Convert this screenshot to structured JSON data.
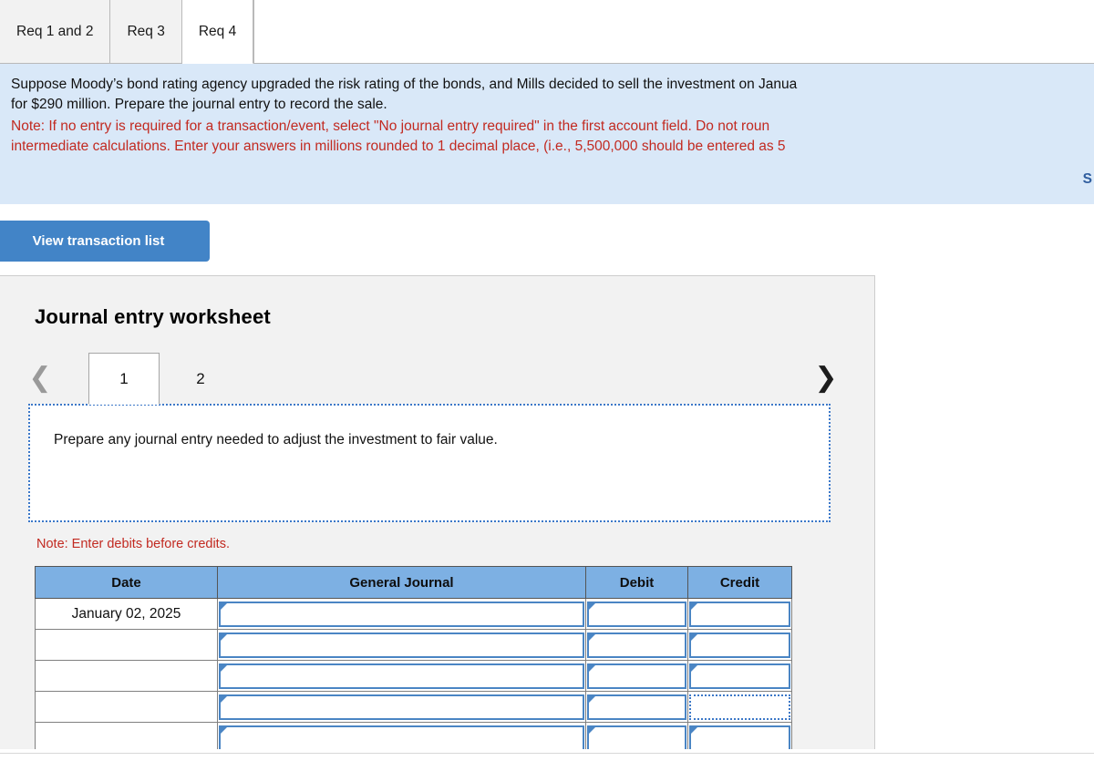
{
  "tabs": [
    {
      "label": "Req 1 and 2",
      "active": false
    },
    {
      "label": "Req 3",
      "active": false
    },
    {
      "label": "Req 4",
      "active": true
    }
  ],
  "banner": {
    "paragraph_line1": "Suppose Moody’s bond rating agency upgraded the risk rating of the bonds, and Mills decided to sell the investment on Janua",
    "paragraph_line2": "for $290 million. Prepare the journal entry to record the sale.",
    "note_line1": "Note: If no entry is required for a transaction/event, select \"No journal entry required\" in the first account field. Do not roun",
    "note_line2": "intermediate calculations. Enter your answers in millions rounded to 1 decimal place, (i.e., 5,500,000 should be entered as 5",
    "show_link": "S",
    "background_color": "#d9e8f8",
    "note_color": "#c22a21"
  },
  "buttons": {
    "view_transaction_list": "View transaction list"
  },
  "worksheet": {
    "title": "Journal entry worksheet",
    "pager": {
      "prev_icon": "chevron-left",
      "next_icon": "chevron-right",
      "pages": [
        {
          "label": "1",
          "active": true
        },
        {
          "label": "2",
          "active": false
        }
      ]
    },
    "requirement_text": "Prepare any journal entry needed to adjust the investment to fair value.",
    "debits_note": "Note: Enter debits before credits."
  },
  "journal_table": {
    "columns": [
      "Date",
      "General Journal",
      "Debit",
      "Credit"
    ],
    "rows": [
      {
        "date": "January 02, 2025",
        "general_journal": "",
        "debit": "",
        "credit": "",
        "focused": ""
      },
      {
        "date": "",
        "general_journal": "",
        "debit": "",
        "credit": "",
        "focused": ""
      },
      {
        "date": "",
        "general_journal": "",
        "debit": "",
        "credit": "",
        "focused": ""
      },
      {
        "date": "",
        "general_journal": "",
        "debit": "",
        "credit": "",
        "focused": "credit"
      },
      {
        "date": "",
        "general_journal": "",
        "debit": "",
        "credit": "",
        "focused": ""
      }
    ]
  },
  "colors": {
    "accent_blue": "#4284c7",
    "header_blue": "#7db0e3",
    "input_border": "#4a85c4",
    "panel_grey": "#f2f2f2"
  }
}
